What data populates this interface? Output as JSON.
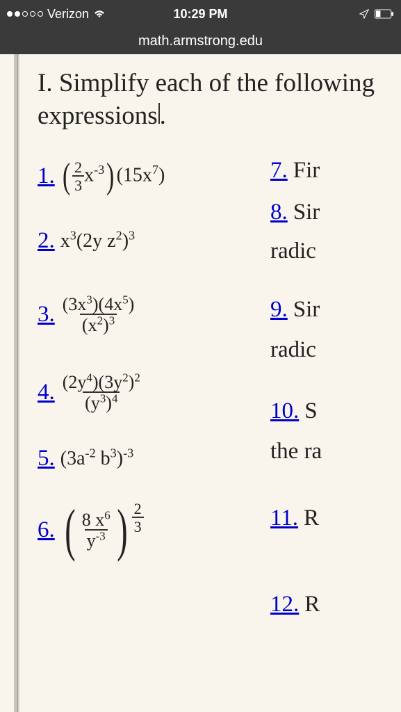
{
  "status": {
    "carrier": "Verizon",
    "time": "10:29 PM"
  },
  "url": "math.armstrong.edu",
  "heading": "I. Simplify each of the following expressions.",
  "left": {
    "p1": {
      "num": "1."
    },
    "p2": {
      "num": "2."
    },
    "p3": {
      "num": "3."
    },
    "p4": {
      "num": "4."
    },
    "p5": {
      "num": "5."
    },
    "p6": {
      "num": "6."
    }
  },
  "right": {
    "p7": {
      "num": "7.",
      "text": " Fir"
    },
    "p8": {
      "num": "8.",
      "text": " Sir"
    },
    "p8b": "radic",
    "p9": {
      "num": "9.",
      "text": " Sir"
    },
    "p9b": "radic",
    "p10": {
      "num": "10.",
      "text": " S"
    },
    "p10b": "the ra",
    "p11": {
      "num": "11.",
      "text": " R"
    },
    "p12": {
      "num": "12.",
      "text": " R"
    }
  },
  "math_expressions": {
    "p1": "(2/3 x^-3)(15x^7)",
    "p2": "x^3(2yz^2)^3",
    "p3": "(3x^3)(4x^5) / (x^2)^3",
    "p4": "(2y^4)(3y^2)^2 / (y^3)^4",
    "p5": "(3a^-2 b^3)^-3",
    "p6": "(8x^6 / y^-3)^(2/3)"
  }
}
